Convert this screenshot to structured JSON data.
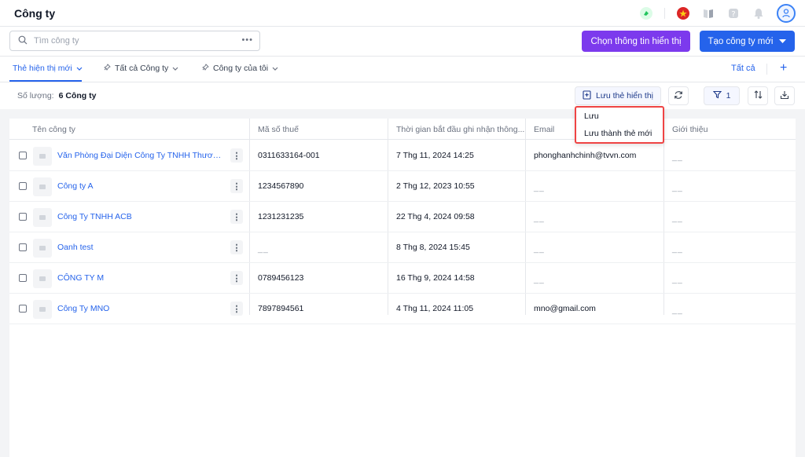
{
  "header": {
    "title": "Công ty"
  },
  "search": {
    "placeholder": "Tìm công ty",
    "value": ""
  },
  "actions": {
    "choose_display": "Chọn thông tin hiển thị",
    "create_company": "Tạo công ty mới"
  },
  "tabs": [
    {
      "label": "Thẻ hiện thị mới",
      "active": true
    },
    {
      "label": "Tất cả Công ty",
      "active": false
    },
    {
      "label": "Công ty của tôi",
      "active": false
    }
  ],
  "tab_all": "Tất cả",
  "count": {
    "label": "Số lượng:",
    "value": "6 Công ty"
  },
  "toolbar": {
    "save_view": "Lưu thẻ hiển thị",
    "filter_count": "1"
  },
  "dropdown": {
    "items": [
      "Lưu",
      "Lưu thành thẻ mới"
    ]
  },
  "table": {
    "columns": [
      "Tên công ty",
      "Mã số thuế",
      "Thời gian bắt đầu ghi nhận thông...",
      "Email",
      "Giới thiệu"
    ],
    "rows": [
      {
        "name": "Văn Phòng Đại Diện Công Ty TNHH Thương...",
        "tax": "0311633164-001",
        "time": "7 Thg 11, 2024 14:25",
        "email": "phonghanhchinh@tvvn.com",
        "intro": "__"
      },
      {
        "name": "Công ty A",
        "tax": "1234567890",
        "time": "2 Thg 12, 2023 10:55",
        "email": "__",
        "intro": "__"
      },
      {
        "name": "Công Ty TNHH ACB",
        "tax": "1231231235",
        "time": "22 Thg 4, 2024 09:58",
        "email": "__",
        "intro": "__"
      },
      {
        "name": "Oanh test",
        "tax": "__",
        "time": "8 Thg 8, 2024 15:45",
        "email": "__",
        "intro": "__"
      },
      {
        "name": "CÔNG TY M",
        "tax": "0789456123",
        "time": "16 Thg 9, 2024 14:58",
        "email": "__",
        "intro": "__"
      },
      {
        "name": "Công Ty MNO",
        "tax": "7897894561",
        "time": "4 Thg 11, 2024 11:05",
        "email": "mno@gmail.com",
        "intro": "__"
      }
    ]
  },
  "colors": {
    "primary": "#2563eb",
    "purple": "#7c3aed",
    "highlight": "#ef4444"
  }
}
